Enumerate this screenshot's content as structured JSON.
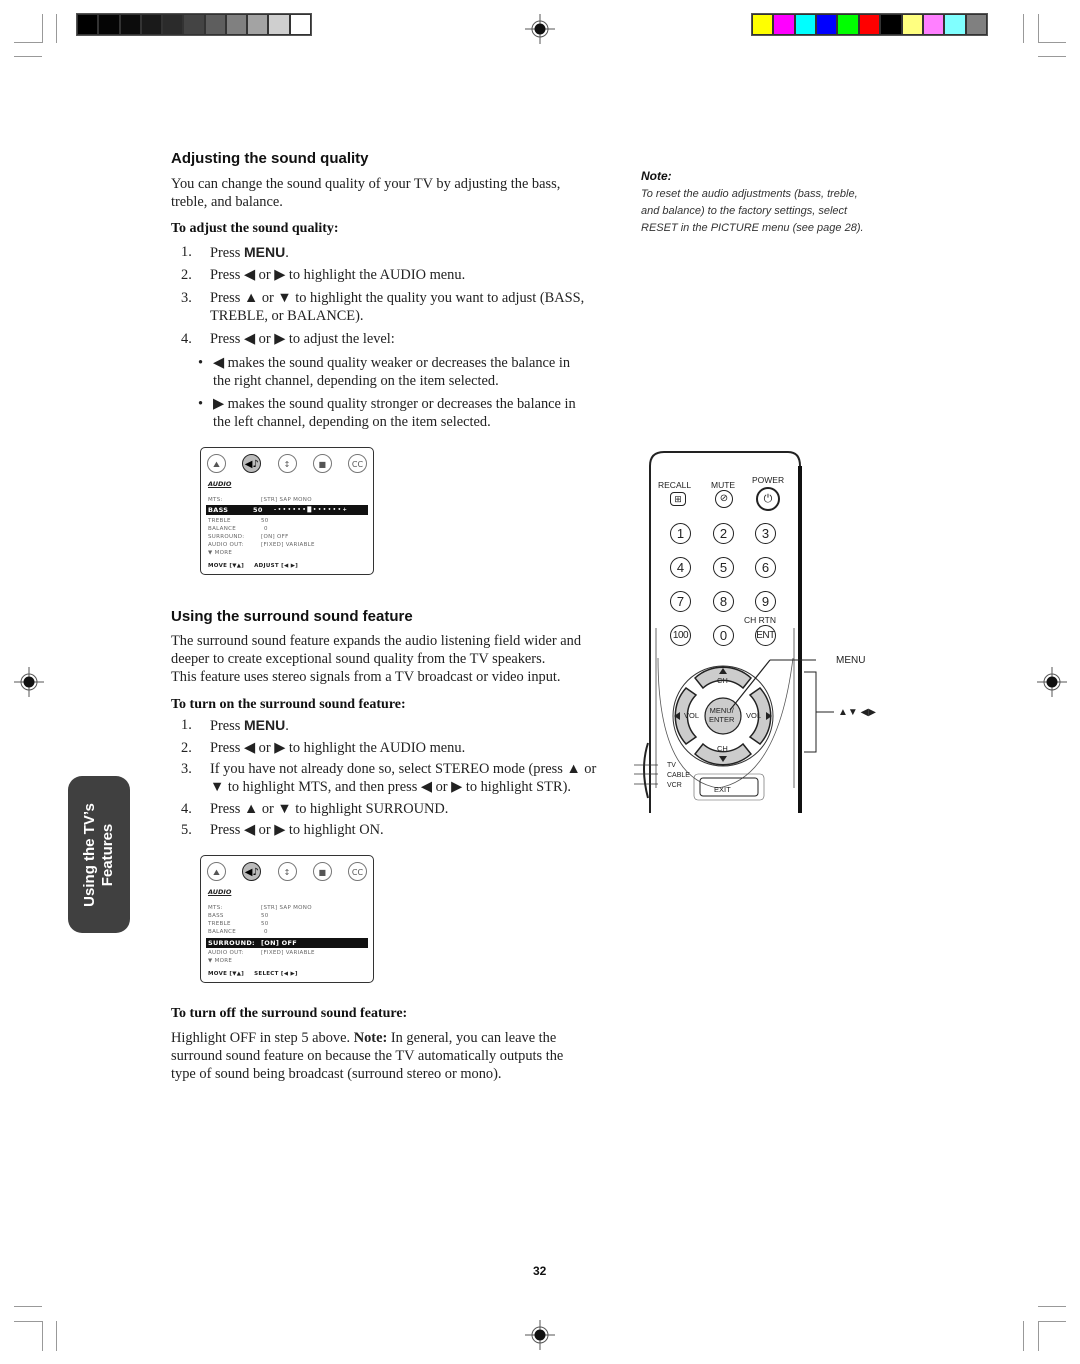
{
  "color_bars": {
    "grayscale": [
      "#000000",
      "#050505",
      "#0c0c0c",
      "#1a1a1a",
      "#2b2b2b",
      "#444444",
      "#5e5e5e",
      "#808080",
      "#a3a3a3",
      "#cfcfcf",
      "#ffffff"
    ],
    "colors": [
      "#ffff00",
      "#ff00ff",
      "#00ffff",
      "#0000ff",
      "#00ff00",
      "#ff0000",
      "#000000",
      "#ffff80",
      "#ff80ff",
      "#80ffff",
      "#808080"
    ]
  },
  "section1": {
    "heading": "Adjusting the sound quality",
    "intro_line1": "You can change the sound quality of your TV by adjusting the bass,",
    "intro_line2": "treble, and balance.",
    "subheading": "To adjust the sound quality:",
    "steps": [
      {
        "num": "1.",
        "pre": "Press ",
        "menu": "MENU",
        "post": "."
      },
      {
        "num": "2.",
        "text": "Press ◀ or ▶ to highlight the AUDIO menu."
      },
      {
        "num": "3.",
        "line1": "Press ▲ or ▼ to highlight the quality you want to adjust (BASS,",
        "line2": "TREBLE, or BALANCE)."
      },
      {
        "num": "4.",
        "text": "Press ◀ or ▶ to adjust the level:"
      }
    ],
    "bullets": [
      {
        "line1": "◀ makes the sound quality weaker or decreases the balance in",
        "line2": "the right channel, depending on the item selected."
      },
      {
        "line1": "▶ makes the sound quality stronger or decreases the balance in",
        "line2": "the left channel, depending on the item selected."
      }
    ]
  },
  "note": {
    "heading": "Note:",
    "line1": "To reset the audio adjustments (bass, treble,",
    "line2": "and balance) to the factory settings, select",
    "line3": "RESET in the PICTURE menu (see page 28)."
  },
  "osd1": {
    "icons": [
      "picture-icon",
      "audio-icon",
      "setup-icon",
      "theater-icon",
      "cc-icon"
    ],
    "icon_glyphs": [
      "⛰",
      "◀♪",
      "↕",
      "■",
      "CC"
    ],
    "title": "AUDIO",
    "rows": [
      {
        "label": "MTS:",
        "value": "[STR] SAP MONO"
      },
      {
        "label": "BASS",
        "value": "50",
        "slider": "- • • • • • • █ • • • • • • +",
        "highlighted": true
      },
      {
        "label": "TREBLE",
        "value": "50"
      },
      {
        "label": "BALANCE",
        "value": "0"
      },
      {
        "label": "SURROUND:",
        "value": "[ON] OFF"
      },
      {
        "label": "AUDIO OUT:",
        "value": "[FIXED] VARIABLE"
      },
      {
        "label": "▼ MORE",
        "value": ""
      }
    ],
    "footer_left": "MOVE [▼▲]",
    "footer_right": "ADJUST [◀ ▶]",
    "bass_level": 50
  },
  "section2": {
    "heading": "Using the surround sound feature",
    "intro_line1": "The surround sound feature expands the audio listening field wider and",
    "intro_line2": "deeper to create exceptional sound quality from the TV speakers.",
    "intro_line3": "This feature uses stereo signals from a TV broadcast or video input.",
    "subheading": "To turn on the surround sound feature:",
    "steps": [
      {
        "num": "1.",
        "pre": "Press ",
        "menu": "MENU",
        "post": "."
      },
      {
        "num": "2.",
        "text": "Press ◀ or ▶ to highlight the AUDIO menu."
      },
      {
        "num": "3.",
        "line1": "If you have not already done so, select STEREO mode (press ▲ or",
        "line2": "▼ to highlight MTS, and then press ◀ or ▶ to highlight STR)."
      },
      {
        "num": "4.",
        "text": "Press ▲ or ▼ to highlight SURROUND."
      },
      {
        "num": "5.",
        "text": "Press ◀ or ▶ to highlight ON."
      }
    ]
  },
  "osd2": {
    "title": "AUDIO",
    "rows": [
      {
        "label": "MTS:",
        "value": "[STR] SAP MONO"
      },
      {
        "label": "BASS",
        "value": "50"
      },
      {
        "label": "TREBLE",
        "value": "50"
      },
      {
        "label": "BALANCE",
        "value": "0"
      },
      {
        "label": "SURROUND:",
        "value": "[ON] OFF",
        "highlighted": true
      },
      {
        "label": "AUDIO OUT:",
        "value": "[FIXED] VARIABLE"
      },
      {
        "label": "▼ MORE",
        "value": ""
      }
    ],
    "footer_left": "MOVE [▼▲]",
    "footer_right": "SELECT [◀ ▶]"
  },
  "section3": {
    "subheading": "To turn off the surround sound feature:",
    "line1_pre": "Highlight OFF in step 5 above. ",
    "line1_bold": "Note:",
    "line1_post": " In general, you can leave the",
    "line2": "surround sound feature on because the TV automatically outputs the",
    "line3": "type of sound being broadcast (surround stereo or mono)."
  },
  "side_tab": {
    "line1": "Using the TV’s",
    "line2": "Features"
  },
  "remote": {
    "labels": {
      "recall": "RECALL",
      "mute": "MUTE",
      "power": "POWER",
      "ch_rtn": "CH RTN",
      "ch": "CH",
      "vol": "VOL",
      "menu_enter_1": "MENU/",
      "menu_enter_2": "ENTER",
      "tv": "TV",
      "cable": "CABLE",
      "vcr": "VCR",
      "exit": "EXIT"
    },
    "digits": [
      "1",
      "2",
      "3",
      "4",
      "5",
      "6",
      "7",
      "8",
      "9",
      "100",
      "0",
      "ENT"
    ],
    "recall_glyph": "⊞",
    "mute_glyph": "⊘",
    "power_glyph": "⏻",
    "callouts": {
      "menu": "MENU",
      "arrows": "▲▼ ◀▶"
    }
  },
  "page_number": "32"
}
